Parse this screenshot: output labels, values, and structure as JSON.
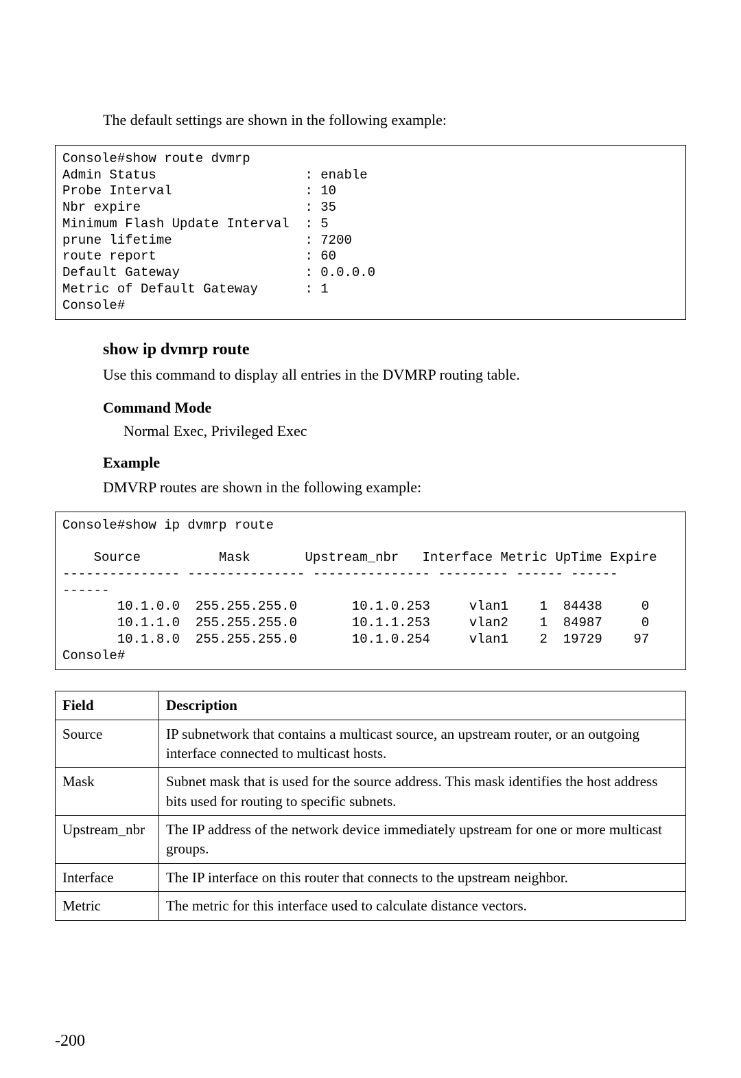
{
  "intro1": "The default settings are shown in the following example:",
  "code1": "Console#show route dvmrp\nAdmin Status                   : enable\nProbe Interval                 : 10\nNbr expire                     : 35\nMinimum Flash Update Interval  : 5\nprune lifetime                 : 7200\nroute report                   : 60\nDefault Gateway                : 0.0.0.0\nMetric of Default Gateway      : 1\nConsole#",
  "heading": "show ip dvmrp route",
  "desc": "Use this command to display all entries in the DVMRP routing table.",
  "cmd_mode_label": "Command Mode",
  "cmd_mode_value": "Normal Exec, Privileged Exec",
  "example_label": "Example",
  "example_intro": "DMVRP routes are shown in the following example:",
  "code2": "Console#show ip dvmrp route\n\n    Source          Mask       Upstream_nbr   Interface Metric UpTime Expire\n--------------- --------------- --------------- --------- ------ ------\n------\n       10.1.0.0  255.255.255.0       10.1.0.253     vlan1    1  84438     0\n       10.1.1.0  255.255.255.0       10.1.1.253     vlan2    1  84987     0\n       10.1.8.0  255.255.255.0       10.1.0.254     vlan1    2  19729    97\nConsole#",
  "table": {
    "header": {
      "field": "Field",
      "description": "Description"
    },
    "rows": [
      {
        "field": "Source",
        "description": "IP subnetwork that contains a multicast source, an upstream router, or an outgoing interface connected to multicast hosts."
      },
      {
        "field": "Mask",
        "description": "Subnet mask that is used for the source address. This mask identifies the host address bits used for routing to specific subnets."
      },
      {
        "field": "Upstream_nbr",
        "description": "The IP address of the network device immediately upstream for one or more multicast groups."
      },
      {
        "field": "Interface",
        "description": "The IP interface on this router that connects to the upstream neighbor."
      },
      {
        "field": "Metric",
        "description": "The metric for this interface used to calculate distance vectors."
      }
    ]
  },
  "page_number": "-200",
  "chart_data": {
    "type": "table",
    "title": "show route dvmrp output",
    "settings": [
      {
        "name": "Admin Status",
        "value": "enable"
      },
      {
        "name": "Probe Interval",
        "value": 10
      },
      {
        "name": "Nbr expire",
        "value": 35
      },
      {
        "name": "Minimum Flash Update Interval",
        "value": 5
      },
      {
        "name": "prune lifetime",
        "value": 7200
      },
      {
        "name": "route report",
        "value": 60
      },
      {
        "name": "Default Gateway",
        "value": "0.0.0.0"
      },
      {
        "name": "Metric of Default Gateway",
        "value": 1
      }
    ],
    "route_table": {
      "columns": [
        "Source",
        "Mask",
        "Upstream_nbr",
        "Interface",
        "Metric",
        "UpTime",
        "Expire"
      ],
      "rows": [
        [
          "10.1.0.0",
          "255.255.255.0",
          "10.1.0.253",
          "vlan1",
          1,
          84438,
          0
        ],
        [
          "10.1.1.0",
          "255.255.255.0",
          "10.1.1.253",
          "vlan2",
          1,
          84987,
          0
        ],
        [
          "10.1.8.0",
          "255.255.255.0",
          "10.1.0.254",
          "vlan1",
          2,
          19729,
          97
        ]
      ]
    }
  }
}
